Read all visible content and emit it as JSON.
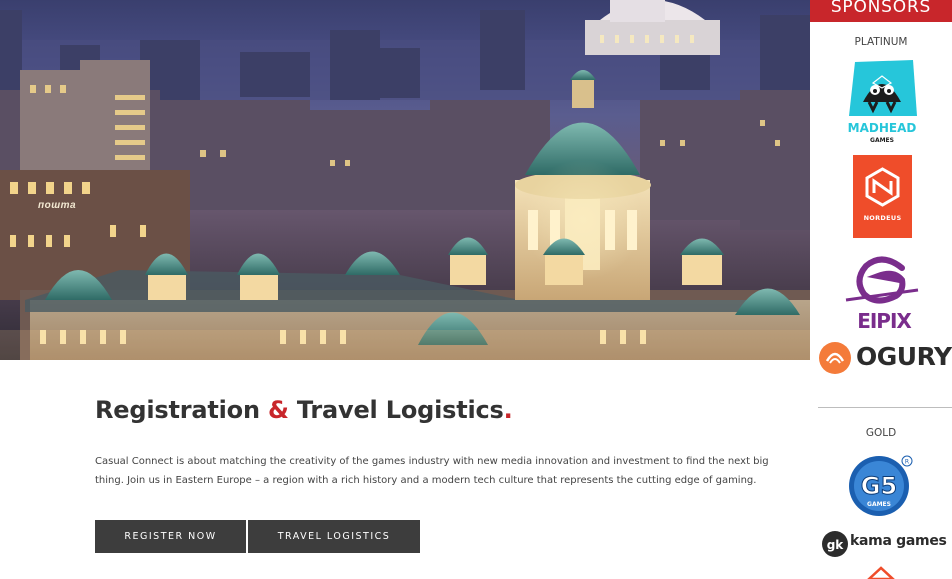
{
  "hero": {
    "sign_text": "пошта"
  },
  "main": {
    "title_part1": "Registration ",
    "title_amp": "&",
    "title_part2": " Travel Logistics",
    "title_dot": ".",
    "intro": "Casual Connect is about matching the creativity of the games industry with new media innovation and investment to find the next big thing. Join us in Eastern Europe – a region with a rich history and a modern tech culture that represents the cutting edge of gaming.",
    "buttons": {
      "register": "REGISTER NOW",
      "travel": "TRAVEL LOGISTICS"
    }
  },
  "sidebar": {
    "header": "SPONSORS",
    "tiers": {
      "platinum": "PLATINUM",
      "gold": "GOLD"
    },
    "logos": {
      "madhead_line1": "MADHEAD",
      "madhead_line2": "GAMES",
      "nordeus": "NORDEUS",
      "eipix": "EIPIX",
      "ogury": "OGURY",
      "g5_line1": "G5",
      "g5_line2": "GAMES",
      "kama": "kama games"
    }
  },
  "colors": {
    "accent": "#c8262b",
    "button_bg": "#3d3d3d",
    "text_dark": "#333333"
  }
}
